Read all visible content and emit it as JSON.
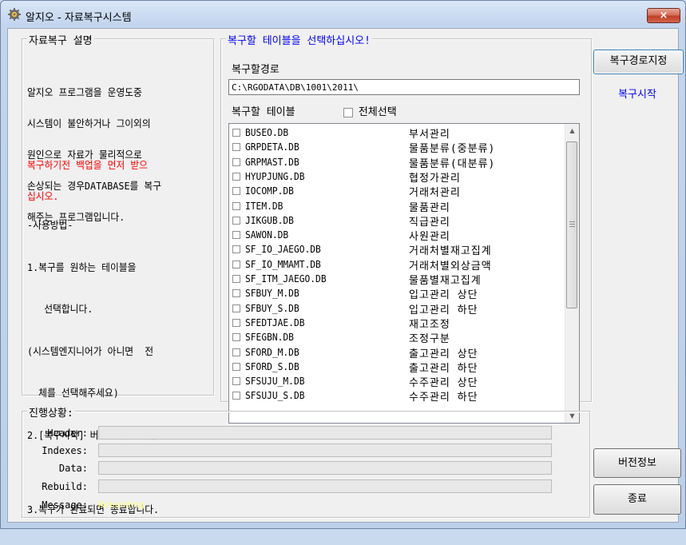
{
  "window": {
    "title": "알지오 - 자료복구시스템",
    "close_label": "×"
  },
  "description_group": {
    "legend": "자료복구 설명",
    "intro_lines": [
      "알지오 프로그램을 운영도중",
      "시스템이 불안하거나 그이외의",
      "원인으로 자료가 물리적으로",
      "손상되는 경우DATABASE를 복구",
      "해주는 프로그램입니다."
    ],
    "warning_lines": [
      "복구하기전 백업을 먼저 받으",
      "십시오."
    ],
    "usage_lines": [
      "-사용방법-",
      "1.복구를 원하는 테이블을",
      "   선택합니다.",
      "(시스템엔지니어가 아니면  전",
      "  체를 선택해주세요)",
      "2.[복구시작] 버튼클릭 합니다.",
      "",
      "3.복구가 완료되면 종료합니다."
    ]
  },
  "table_group": {
    "legend": "복구할 테이블을 선택하십시오!",
    "path_label": "복구할경로",
    "path_value": "C:\\RGODATA\\DB\\1001\\2011\\",
    "tables_label": "복구할 테이블",
    "select_all_label": "전체선택",
    "tables": [
      {
        "file": "BUSEO.DB",
        "desc": "부서관리"
      },
      {
        "file": "GRPDETA.DB",
        "desc": "물품분류(중분류)"
      },
      {
        "file": "GRPMAST.DB",
        "desc": "물품분류(대분류)"
      },
      {
        "file": "HYUPJUNG.DB",
        "desc": "협정가관리"
      },
      {
        "file": "IOCOMP.DB",
        "desc": "거래처관리"
      },
      {
        "file": "ITEM.DB",
        "desc": "물품관리"
      },
      {
        "file": "JIKGUB.DB",
        "desc": "직급관리"
      },
      {
        "file": "SAWON.DB",
        "desc": "사원관리"
      },
      {
        "file": "SF_IO_JAEGO.DB",
        "desc": "거래처별재고집계"
      },
      {
        "file": "SF_IO_MMAMT.DB",
        "desc": "거래처별외상금액"
      },
      {
        "file": "SF_ITM_JAEGO.DB",
        "desc": "물품별재고집계"
      },
      {
        "file": "SFBUY_M.DB",
        "desc": "입고관리 상단"
      },
      {
        "file": "SFBUY_S.DB",
        "desc": "입고관리 하단"
      },
      {
        "file": "SFEDTJAE.DB",
        "desc": "재고조정"
      },
      {
        "file": "SFEGBN.DB",
        "desc": "조정구분"
      },
      {
        "file": "SFORD_M.DB",
        "desc": "출고관리 상단"
      },
      {
        "file": "SFORD_S.DB",
        "desc": "출고관리 하단"
      },
      {
        "file": "SFSUJU_M.DB",
        "desc": "수주관리 상단"
      },
      {
        "file": "SFSUJU_S.DB",
        "desc": "수주관리 하단"
      }
    ]
  },
  "buttons": {
    "set_path": "복구경로지정",
    "start": "복구시작",
    "version": "버전정보",
    "exit": "종료"
  },
  "progress_group": {
    "legend": "진행상황:",
    "labels": {
      "header": "Header:",
      "indexes": "Indexes:",
      "data": "Data:",
      "rebuild": "Rebuild:",
      "message": "Message:"
    },
    "message_value": "Rebuilding"
  },
  "colors": {
    "warning": "#ff0000",
    "start_button_text": "#0000ff",
    "message_text": "#ffff80"
  }
}
